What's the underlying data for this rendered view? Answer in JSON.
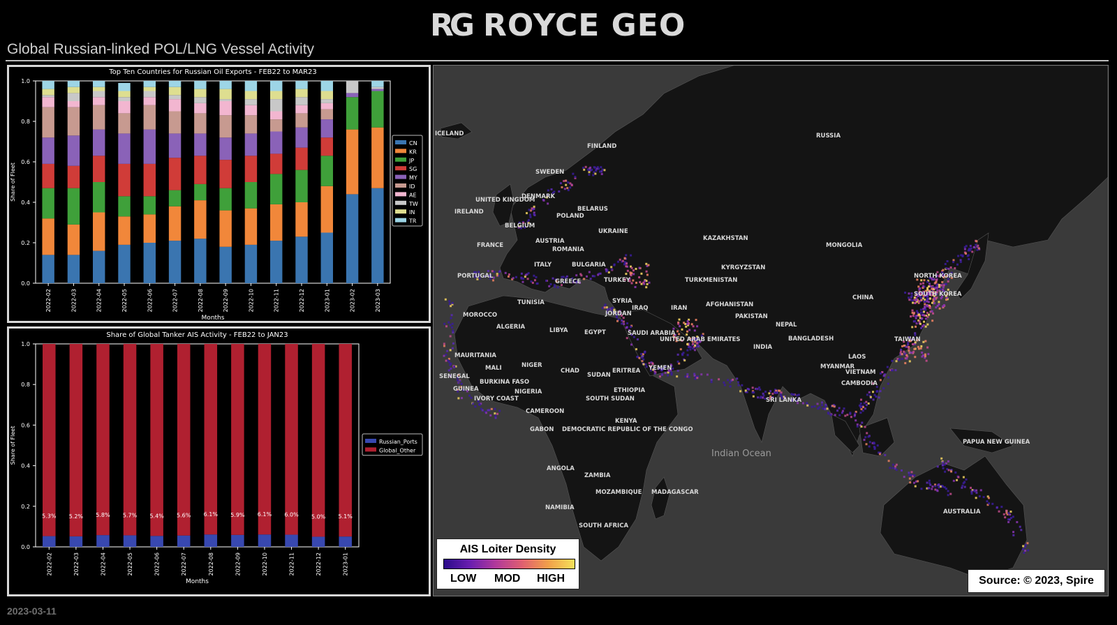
{
  "header": {
    "logo_mark": "RG",
    "logo_text": "ROYCE GEO",
    "title": "Global Russian-linked POL/LNG Vessel Activity"
  },
  "footer": {
    "date": "2023-03-11"
  },
  "colors": {
    "CN": "#3a75b0",
    "KR": "#f1873a",
    "JP": "#3fa03a",
    "SG": "#d03c38",
    "MY": "#8a62b8",
    "ID": "#c79a90",
    "AE": "#f2b6d0",
    "TW": "#c8c8c8",
    "IN": "#dede90",
    "TR": "#9dd5e6",
    "Russian_Ports": "#3848b0",
    "Global_Other": "#b02030",
    "map_background": "#3a3a3a",
    "land": "#141414"
  },
  "map": {
    "labels": [
      "ICELAND",
      "FINLAND",
      "SWEDEN",
      "RUSSIA",
      "UNITED KINGDOM",
      "IRELAND",
      "DENMARK",
      "BELARUS",
      "POLAND",
      "BELGIUM",
      "UKRAINE",
      "KAZAKHSTAN",
      "MONGOLIA",
      "FRANCE",
      "AUSTRIA",
      "ROMANIA",
      "ITALY",
      "BULGARIA",
      "PORTUGAL",
      "GREECE",
      "TURKEY",
      "TURKMENISTAN",
      "KYRGYZSTAN",
      "NORTH KOREA",
      "SOUTH KOREA",
      "CHINA",
      "TUNISIA",
      "SYRIA",
      "IRAQ",
      "IRAN",
      "AFGHANISTAN",
      "MOROCCO",
      "JORDAN",
      "PAKISTAN",
      "ALGERIA",
      "LIBYA",
      "EGYPT",
      "SAUDI ARABIA",
      "UNITED ARAB EMIRATES",
      "NEPAL",
      "BANGLADESH",
      "INDIA",
      "MAURITANIA",
      "MALI",
      "NIGER",
      "CHAD",
      "SUDAN",
      "ERITREA",
      "YEMEN",
      "LAOS",
      "MYANMAR",
      "VIETNAM",
      "TAIWAN",
      "SENEGAL",
      "GUINEA",
      "BURKINA FASO",
      "IVORY COAST",
      "NIGERIA",
      "ETHIOPIA",
      "CAMBODIA",
      "SOUTH SUDAN",
      "SRI LANKA",
      "CAMEROON",
      "GABON",
      "DEMOCRATIC REPUBLIC OF THE CONGO",
      "KENYA",
      "Indian Ocean",
      "PAPUA NEW GUINEA",
      "ANGOLA",
      "ZAMBIA",
      "MOZAMBIQUE",
      "MADAGASCAR",
      "NAMIBIA",
      "SOUTH AFRICA",
      "AUSTRALIA"
    ],
    "legend": {
      "title": "AIS Loiter Density",
      "low": "LOW",
      "mod": "MOD",
      "high": "HIGH"
    },
    "source": "Source: © 2023, Spire"
  },
  "chart_data": [
    {
      "type": "bar",
      "stacked": true,
      "title": "Top Ten Countries for Russian Oil Exports - FEB22 to MAR23",
      "xlabel": "Months",
      "ylabel": "Share of Fleet",
      "ylim": [
        0,
        1.0
      ],
      "yticks": [
        "0.0",
        "0.2",
        "0.4",
        "0.6",
        "0.8",
        "1.0"
      ],
      "legend_position": "right",
      "categories": [
        "2022-02",
        "2022-03",
        "2022-04",
        "2022-05",
        "2022-06",
        "2022-07",
        "2022-08",
        "2022-09",
        "2022-10",
        "2022-11",
        "2022-12",
        "2023-01",
        "2023-02",
        "2023-03"
      ],
      "series": [
        {
          "name": "CN",
          "values": [
            0.14,
            0.14,
            0.16,
            0.19,
            0.2,
            0.21,
            0.22,
            0.18,
            0.19,
            0.21,
            0.23,
            0.25,
            0.44,
            0.47
          ]
        },
        {
          "name": "KR",
          "values": [
            0.18,
            0.15,
            0.19,
            0.14,
            0.14,
            0.17,
            0.19,
            0.18,
            0.18,
            0.18,
            0.17,
            0.23,
            0.32,
            0.3
          ]
        },
        {
          "name": "JP",
          "values": [
            0.15,
            0.18,
            0.15,
            0.1,
            0.09,
            0.08,
            0.08,
            0.11,
            0.13,
            0.15,
            0.16,
            0.15,
            0.16,
            0.18
          ]
        },
        {
          "name": "SG",
          "values": [
            0.12,
            0.11,
            0.13,
            0.16,
            0.16,
            0.16,
            0.14,
            0.14,
            0.13,
            0.1,
            0.11,
            0.09,
            0.0,
            0.0
          ]
        },
        {
          "name": "MY",
          "values": [
            0.13,
            0.15,
            0.13,
            0.15,
            0.17,
            0.12,
            0.11,
            0.11,
            0.11,
            0.11,
            0.1,
            0.09,
            0.02,
            0.01
          ]
        },
        {
          "name": "ID",
          "values": [
            0.15,
            0.14,
            0.12,
            0.1,
            0.12,
            0.11,
            0.1,
            0.11,
            0.09,
            0.06,
            0.07,
            0.05,
            0.0,
            0.0
          ]
        },
        {
          "name": "AE",
          "values": [
            0.05,
            0.03,
            0.04,
            0.06,
            0.04,
            0.06,
            0.05,
            0.07,
            0.05,
            0.04,
            0.04,
            0.03,
            0.0,
            0.0
          ]
        },
        {
          "name": "TW",
          "values": [
            0.01,
            0.04,
            0.03,
            0.02,
            0.03,
            0.02,
            0.03,
            0.01,
            0.03,
            0.06,
            0.04,
            0.02,
            0.06,
            0.01
          ]
        },
        {
          "name": "IN",
          "values": [
            0.03,
            0.03,
            0.02,
            0.03,
            0.02,
            0.04,
            0.04,
            0.05,
            0.04,
            0.04,
            0.04,
            0.04,
            0.0,
            0.0
          ]
        },
        {
          "name": "TR",
          "values": [
            0.04,
            0.03,
            0.03,
            0.04,
            0.03,
            0.03,
            0.04,
            0.04,
            0.05,
            0.05,
            0.04,
            0.05,
            0.0,
            0.03
          ]
        }
      ]
    },
    {
      "type": "bar",
      "stacked": true,
      "title": "Share of Global Tanker AIS Activity - FEB22 to JAN23",
      "xlabel": "Months",
      "ylabel": "Share of Fleet",
      "ylim": [
        0,
        1.0
      ],
      "yticks": [
        "0.0",
        "0.2",
        "0.4",
        "0.6",
        "0.8",
        "1.0"
      ],
      "legend_position": "right",
      "categories": [
        "2022-02",
        "2022-03",
        "2022-04",
        "2022-05",
        "2022-06",
        "2022-07",
        "2022-08",
        "2022-09",
        "2022-10",
        "2022-11",
        "2022-12",
        "2023-01"
      ],
      "series": [
        {
          "name": "Russian_Ports",
          "values": [
            0.053,
            0.052,
            0.058,
            0.057,
            0.054,
            0.056,
            0.061,
            0.059,
            0.061,
            0.06,
            0.05,
            0.051
          ]
        },
        {
          "name": "Global_Other",
          "values": [
            0.947,
            0.948,
            0.942,
            0.943,
            0.946,
            0.944,
            0.939,
            0.941,
            0.939,
            0.94,
            0.95,
            0.949
          ]
        }
      ],
      "data_labels": [
        "5.3%",
        "5.2%",
        "5.8%",
        "5.7%",
        "5.4%",
        "5.6%",
        "6.1%",
        "5.9%",
        "6.1%",
        "6.0%",
        "5.0%",
        "5.1%"
      ]
    }
  ]
}
